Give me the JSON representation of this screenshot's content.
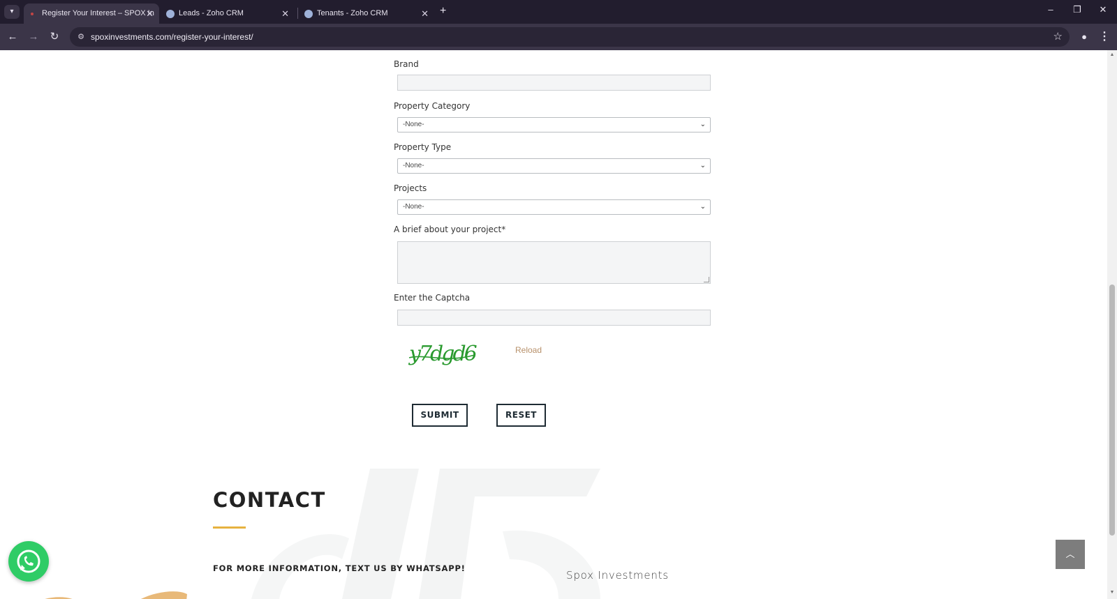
{
  "browser": {
    "tabs": [
      {
        "title": "Register Your Interest – SPOX In",
        "active": true
      },
      {
        "title": "Leads - Zoho CRM",
        "active": false
      },
      {
        "title": "Tenants - Zoho CRM",
        "active": false
      }
    ],
    "new_tab": "+",
    "url": "spoxinvestments.com/register-your-interest/"
  },
  "form": {
    "brand_label": "Brand",
    "brand_value": "",
    "property_category_label": "Property Category",
    "property_category_value": "-None-",
    "property_type_label": "Property Type",
    "property_type_value": "-None-",
    "projects_label": "Projects",
    "projects_value": "-None-",
    "brief_label": "A brief about your project*",
    "brief_value": "",
    "captcha_label": "Enter the Captcha",
    "captcha_value": "",
    "captcha_text": "y7dgd6",
    "reload_label": "Reload",
    "submit_label": "SUBMIT",
    "reset_label": "RESET"
  },
  "contact": {
    "title": "CONTACT",
    "info": "FOR MORE INFORMATION, TEXT US BY WHATSAPP!",
    "company": "Spox Investments"
  },
  "colors": {
    "accent_gold": "#e6b23f",
    "reload_link": "#b7906a",
    "whatsapp_green": "#2fcc66",
    "captcha_green": "#2a9a2f"
  },
  "icons": {
    "whatsapp": "whatsapp-icon",
    "back_to_top": "chevron-up-icon"
  }
}
